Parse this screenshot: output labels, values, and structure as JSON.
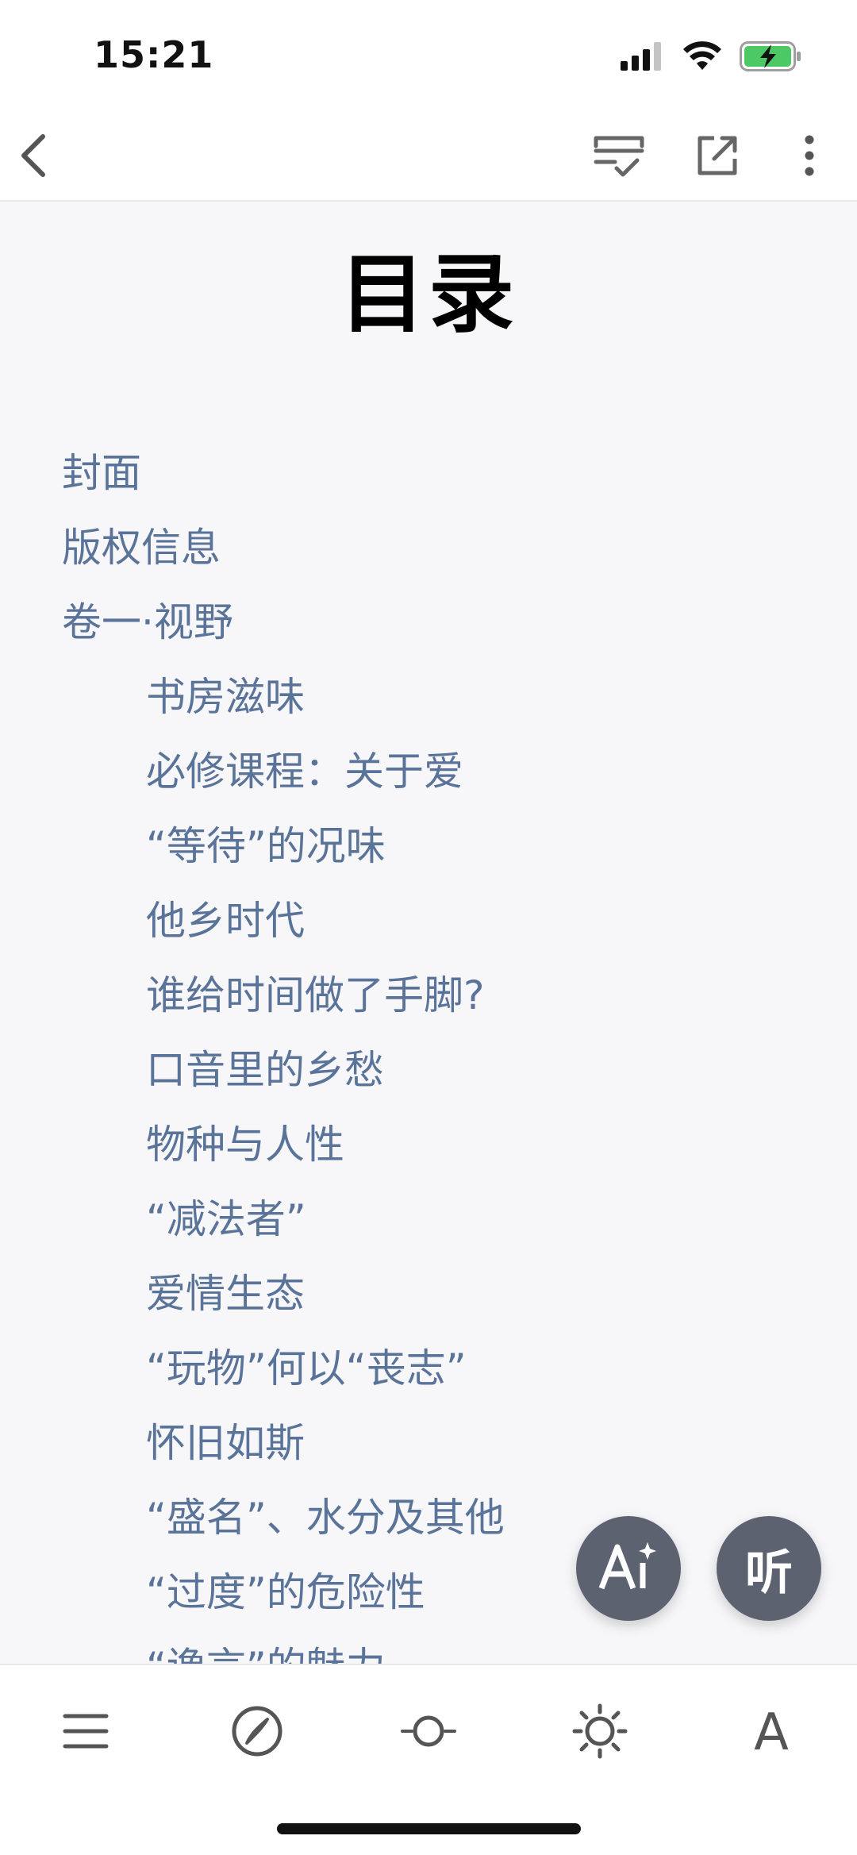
{
  "status": {
    "time": "15:21",
    "signal_icon": "cellular-signal-icon",
    "wifi_icon": "wifi-icon",
    "battery_icon": "battery-charging-icon",
    "battery_color": "#4cc864"
  },
  "nav": {
    "back_icon": "chevron-left-icon",
    "notes_icon": "notes-check-icon",
    "share_icon": "external-share-icon",
    "more_icon": "more-vertical-icon"
  },
  "toc": {
    "title": "目录",
    "items": [
      {
        "label": "封面",
        "level": 1
      },
      {
        "label": "版权信息",
        "level": 1
      },
      {
        "label": "卷一·视野",
        "level": 1
      },
      {
        "label": "书房滋味",
        "level": 2
      },
      {
        "label": "必修课程：关于爱",
        "level": 2
      },
      {
        "label": "“等待”的况味",
        "level": 2
      },
      {
        "label": "他乡时代",
        "level": 2
      },
      {
        "label": "谁给时间做了手脚?",
        "level": 2
      },
      {
        "label": "口音里的乡愁",
        "level": 2
      },
      {
        "label": "物种与人性",
        "level": 2
      },
      {
        "label": "“减法者”",
        "level": 2
      },
      {
        "label": "爱情生态",
        "level": 2
      },
      {
        "label": "“玩物”何以“丧志”",
        "level": 2
      },
      {
        "label": "怀旧如斯",
        "level": 2
      },
      {
        "label": "“盛名”、水分及其他",
        "level": 2
      },
      {
        "label": "“过度”的危险性",
        "level": 2
      },
      {
        "label": "“谗言”的魅力",
        "level": 2
      }
    ],
    "link_color": "#5a7399"
  },
  "fab": {
    "ai_label": "Ai",
    "listen_label": "听"
  },
  "toolbar": {
    "menu_icon": "menu-icon",
    "compass_icon": "compass-icon",
    "progress_icon": "progress-slider-icon",
    "brightness_icon": "brightness-icon",
    "font_label": "A"
  }
}
